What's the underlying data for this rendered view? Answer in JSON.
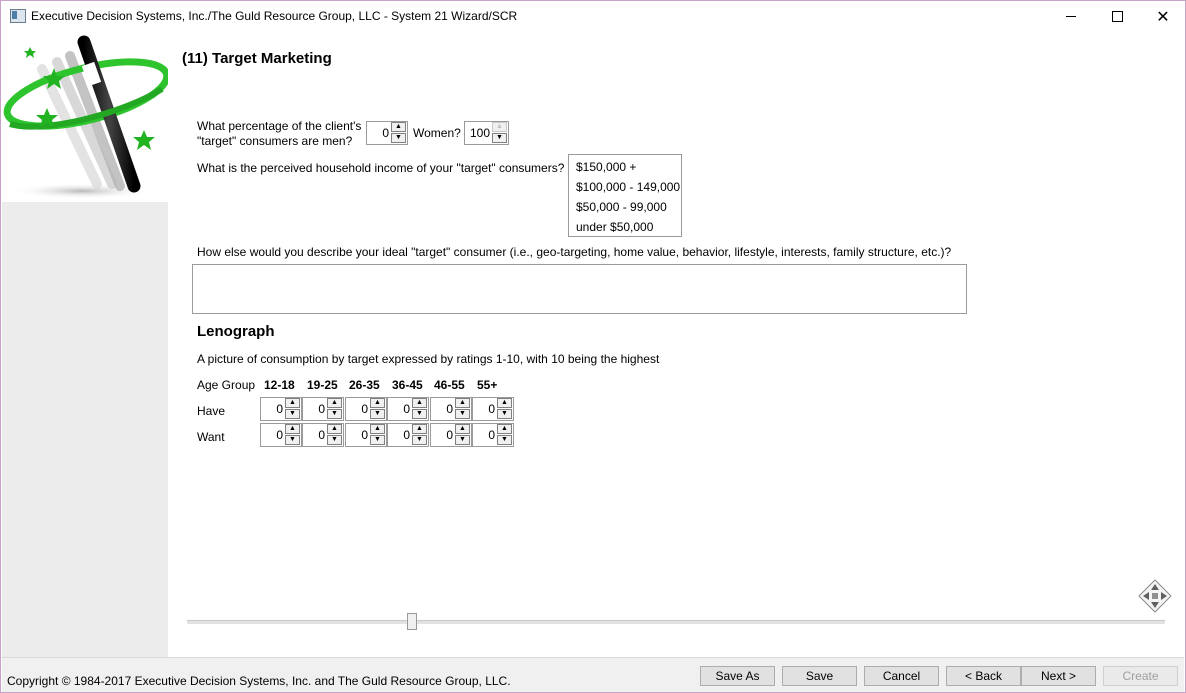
{
  "window": {
    "title": "Executive Decision Systems, Inc./The Guld Resource Group, LLC - System 21 Wizard/SCR"
  },
  "step": {
    "title": "(11) Target Marketing"
  },
  "gender": {
    "question": "What percentage of the client's \"target\" consumers are men?",
    "men_value": "0",
    "women_label": "Women?",
    "women_value": "100"
  },
  "income": {
    "question": "What is the perceived household income of your \"target\" consumers?",
    "options": [
      "$150,000 +",
      "$100,000 - 149,000",
      "$50,000 - 99,000",
      "under $50,000"
    ]
  },
  "describe": {
    "question": "How else would you describe your ideal \"target\" consumer (i.e., geo-targeting, home value, behavior, lifestyle, interests, family structure, etc.)?",
    "value": ""
  },
  "lenograph": {
    "title": "Lenograph",
    "description": "A picture of consumption by target expressed by ratings 1-10, with 10 being the highest",
    "age_group_label": "Age Group",
    "age_groups": [
      "12-18",
      "19-25",
      "26-35",
      "36-45",
      "46-55",
      "55+"
    ],
    "rows": [
      {
        "label": "Have",
        "values": [
          "0",
          "0",
          "0",
          "0",
          "0",
          "0"
        ]
      },
      {
        "label": "Want",
        "values": [
          "0",
          "0",
          "0",
          "0",
          "0",
          "0"
        ]
      }
    ]
  },
  "footer": {
    "copyright": "Copyright © 1984-2017 Executive Decision Systems, Inc. and The Guld Resource Group, LLC.",
    "buttons": {
      "save_as": "Save As",
      "save": "Save",
      "cancel": "Cancel",
      "back": "< Back",
      "next": "Next >",
      "create": "Create"
    }
  },
  "icons": {
    "app": "app-window-icon",
    "logo": "magic-wand-logo",
    "move": "move-arrows-icon",
    "spin_up": "chevron-up-icon",
    "spin_down": "chevron-down-icon"
  },
  "colors": {
    "wand_green": "#2ec42e",
    "sidebar_bg": "#ececec",
    "footer_bg": "#f0f0f0"
  }
}
